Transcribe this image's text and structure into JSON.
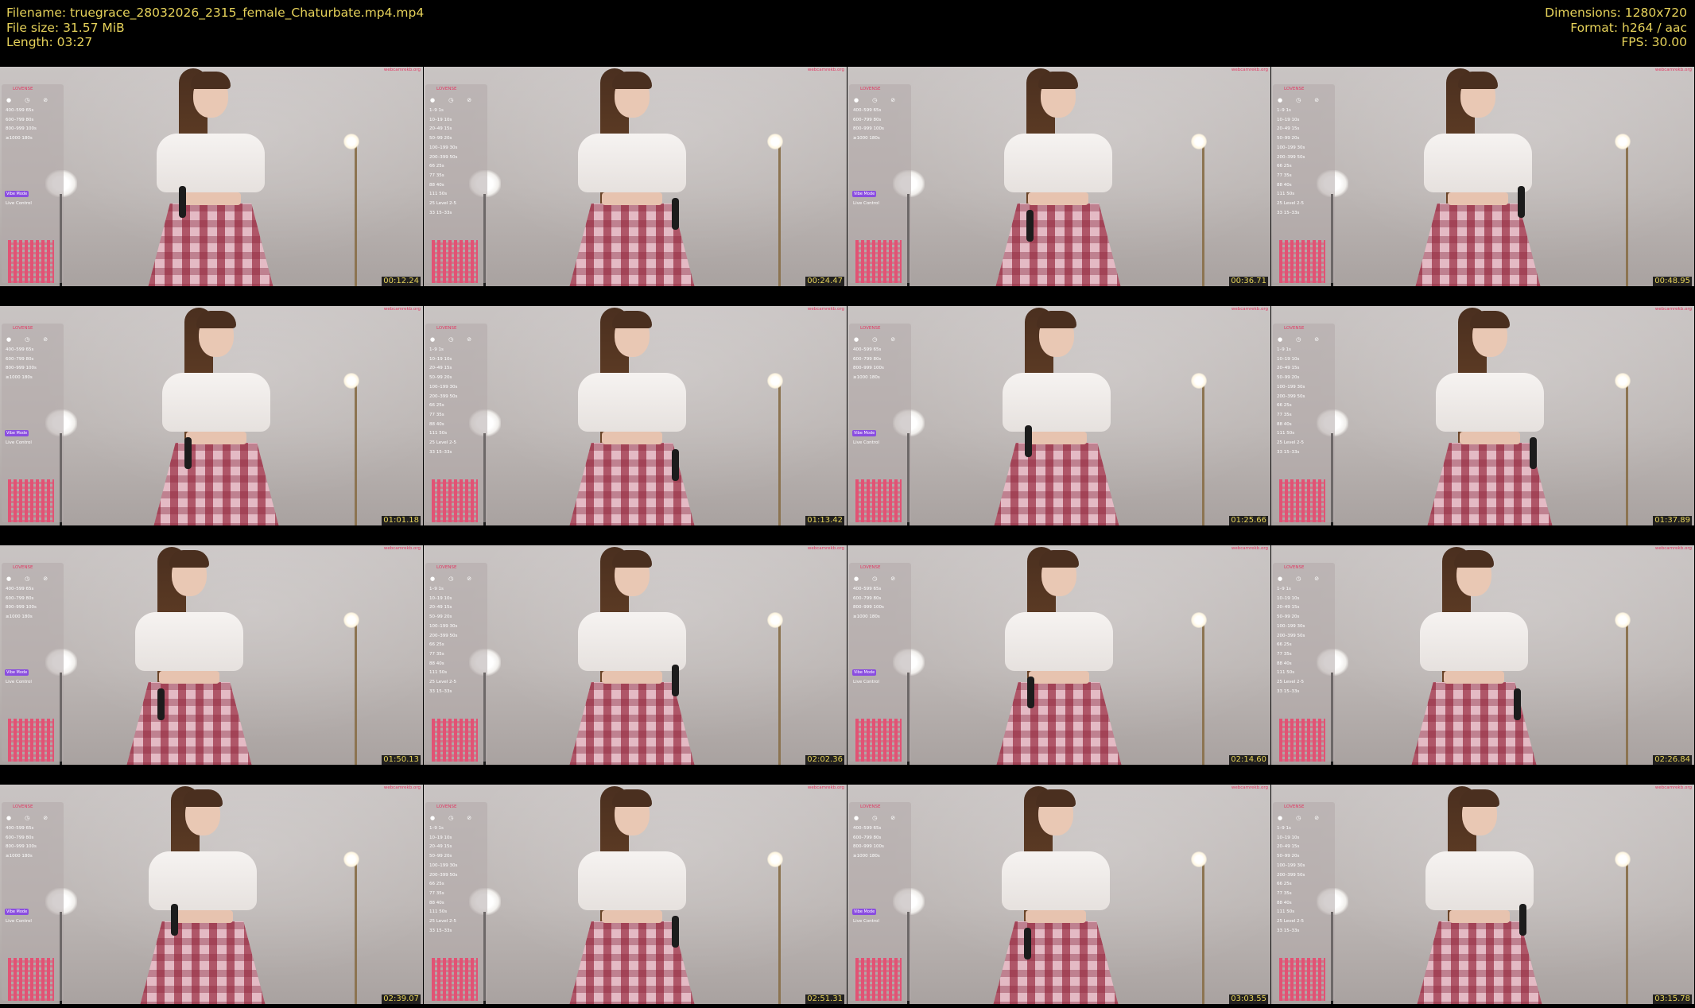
{
  "header": {
    "left": [
      "Filename: truegrace_28032026_2315_female_Chaturbate.mp4.mp4",
      "File size: 31.57 MiB",
      "Length: 03:27"
    ],
    "right": [
      "Dimensions: 1280x720",
      "Format: h264 / aac",
      "FPS: 30.00"
    ]
  },
  "thumbnails": [
    {
      "timestamp": "00:12.24"
    },
    {
      "timestamp": "00:24.47"
    },
    {
      "timestamp": "00:36.71"
    },
    {
      "timestamp": "00:48.95"
    },
    {
      "timestamp": "01:01.18"
    },
    {
      "timestamp": "01:13.42"
    },
    {
      "timestamp": "01:25.66"
    },
    {
      "timestamp": "01:37.89"
    },
    {
      "timestamp": "01:50.13"
    },
    {
      "timestamp": "02:02.36"
    },
    {
      "timestamp": "02:14.60"
    },
    {
      "timestamp": "02:26.84"
    },
    {
      "timestamp": "02:39.07"
    },
    {
      "timestamp": "02:51.31"
    },
    {
      "timestamp": "03:03.55"
    },
    {
      "timestamp": "03:15.78"
    }
  ],
  "overlay": {
    "watermark": "webcamrekb.org",
    "brand": "LOVENSE",
    "short_rows": [
      "400–599   65s",
      "600–799   80s",
      "800–999   100s",
      "≥1000   180s"
    ],
    "long_rows": [
      "1–9   1s",
      "10–19   10s",
      "20–49   15s",
      "50–99   20s",
      "100–199   30s",
      "200–399   50s",
      "66   25s",
      "77   35s",
      "88   40s",
      "111   50s",
      "25   Level 2-5",
      "33   15–33s"
    ],
    "badge": "Vibe Mode",
    "live": "Live Control"
  },
  "colors": {
    "header_text": "#e6d25a",
    "background": "#000000",
    "accent": "#e23a64"
  }
}
